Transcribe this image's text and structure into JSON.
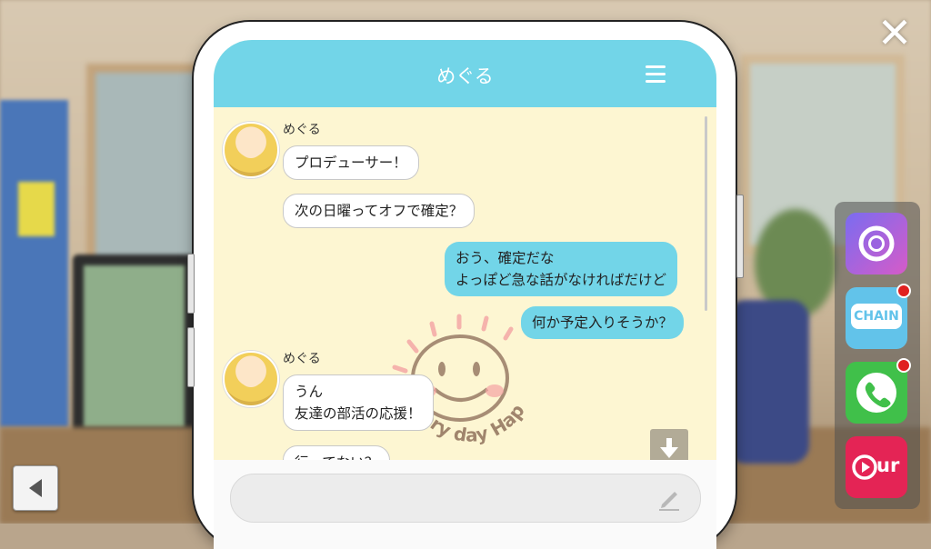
{
  "close_glyph": "✕",
  "chat": {
    "title": "めぐる",
    "messages": [
      {
        "sender": "めぐる",
        "bubbles": [
          "プロデューサー！",
          "次の日曜ってオフで確定？"
        ]
      },
      {
        "sender": "me",
        "bubbles": [
          [
            "おう、確定だな",
            "よっぽど急な話がなければだけど"
          ],
          "何か予定入りそうか？"
        ]
      },
      {
        "sender": "めぐる",
        "bubbles": [
          [
            "うん",
            "友達の部活の応援！"
          ],
          "行ってない？"
        ]
      }
    ]
  },
  "stamp_text": "Every day Happy",
  "dock_apps": [
    {
      "name": "camera-app",
      "label": "",
      "color": "#8c5be0",
      "badge": false
    },
    {
      "name": "chain-app",
      "label": "CHAIN",
      "color": "#62c3ea",
      "badge": true
    },
    {
      "name": "phone-app",
      "label": "",
      "color": "#40c04a",
      "badge": true
    },
    {
      "name": "our-app",
      "label": "ur",
      "color": "#e42455",
      "badge": false
    }
  ],
  "colors": {
    "header": "#72d5e8",
    "chat_bg": "#fdf6d2",
    "out_bubble": "#72d5e8"
  }
}
